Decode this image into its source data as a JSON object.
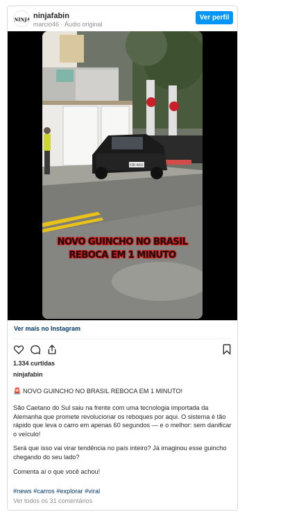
{
  "header": {
    "username": "ninjafabin",
    "subline": "marcio46 · Áudio original",
    "profile_button": "Ver perfil",
    "avatar_text": "NINJA"
  },
  "media": {
    "overlay_line1": "NOVO GUINCHO NO BRASIL",
    "overlay_line2": "REBOCA EM 1 MINUTO",
    "plate_text": "FIB-9A15"
  },
  "more_link": "Ver mais no Instagram",
  "actions": {
    "icons": [
      "heart-icon",
      "comment-icon",
      "share-icon",
      "bookmark-icon"
    ]
  },
  "likes": "1.334 curtidas",
  "caption": {
    "username": "ninjafabin",
    "p1": "🚨 NOVO GUINCHO NO BRASIL REBOCA EM 1 MINUTO!",
    "p2": "São Caetano do Sul saiu na frente com uma tecnologia importada da Alemanha que promete revolucionar os reboques por aqui. O sistema é tão rápido que leva o carro em apenas 60 segundos — e o melhor: sem danificar o veículo!",
    "p3": "Será que isso vai virar tendência no país inteiro? Já imaginou esse guincho chegando do seu lado?",
    "p4": "Comenta aí o que você achou!",
    "p5": "#news #carros #explorar #viral"
  },
  "comments_link": "Ver todos os 31 comentários",
  "colors": {
    "accent": "#0095f6",
    "link": "#00376b",
    "muted": "#8e8e8e",
    "overlay_red": "#d61b1b"
  }
}
